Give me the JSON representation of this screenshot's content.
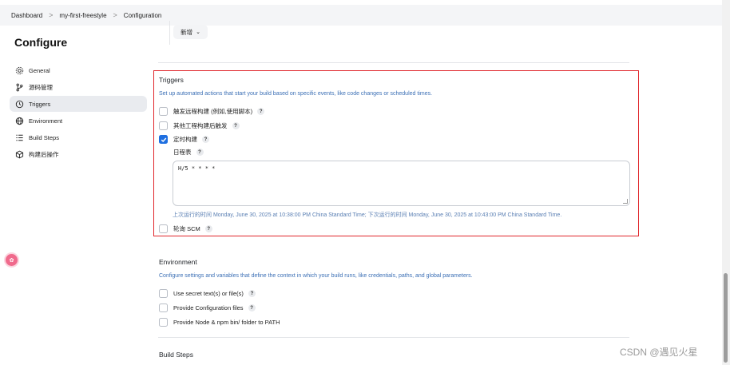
{
  "breadcrumb": {
    "items": [
      "Dashboard",
      "my-first-freestyle",
      "Configuration"
    ],
    "separator": ">"
  },
  "page_title": "Configure",
  "sidebar": {
    "items": [
      {
        "label": "General",
        "icon": "gear-icon",
        "active": false
      },
      {
        "label": "源码管理",
        "icon": "branch-icon",
        "active": false
      },
      {
        "label": "Triggers",
        "icon": "clock-icon",
        "active": true
      },
      {
        "label": "Environment",
        "icon": "globe-icon",
        "active": false
      },
      {
        "label": "Build Steps",
        "icon": "list-icon",
        "active": false
      },
      {
        "label": "构建后操作",
        "icon": "cube-icon",
        "active": false
      }
    ]
  },
  "add_button": {
    "label": "新增",
    "chevron": "⌄"
  },
  "triggers": {
    "title": "Triggers",
    "description": "Set up automated actions that start your build based on specific events, like code changes or scheduled times.",
    "options": [
      {
        "label": "触发远程构建 (例如,使用脚本)",
        "checked": false
      },
      {
        "label": "其他工程构建后触发",
        "checked": false
      },
      {
        "label": "定时构建",
        "checked": true
      }
    ],
    "schedule_label": "日程表",
    "schedule_value": "H/5 * * * *",
    "run_info": "上次运行的时间 Monday, June 30, 2025 at 10:38:00 PM China Standard Time; 下次运行的时间 Monday, June 30, 2025 at 10:43:00 PM China Standard Time.",
    "poll_scm": {
      "label": "轮询 SCM",
      "checked": false
    }
  },
  "environment": {
    "title": "Environment",
    "description": "Configure settings and variables that define the context in which your build runs, like credentials, paths, and global parameters.",
    "options": [
      {
        "label": "Use secret text(s) or file(s)",
        "checked": false,
        "help": true
      },
      {
        "label": "Provide Configuration files",
        "checked": false,
        "help": true
      },
      {
        "label": "Provide Node & npm bin/ folder to PATH",
        "checked": false,
        "help": false
      }
    ]
  },
  "build_steps": {
    "title": "Build Steps"
  },
  "help_glyph": "?",
  "watermark": "CSDN @遇见火星",
  "colors": {
    "accent": "#1f6fe0",
    "highlight_border": "#e0262b",
    "description": "#3b6fb5"
  }
}
